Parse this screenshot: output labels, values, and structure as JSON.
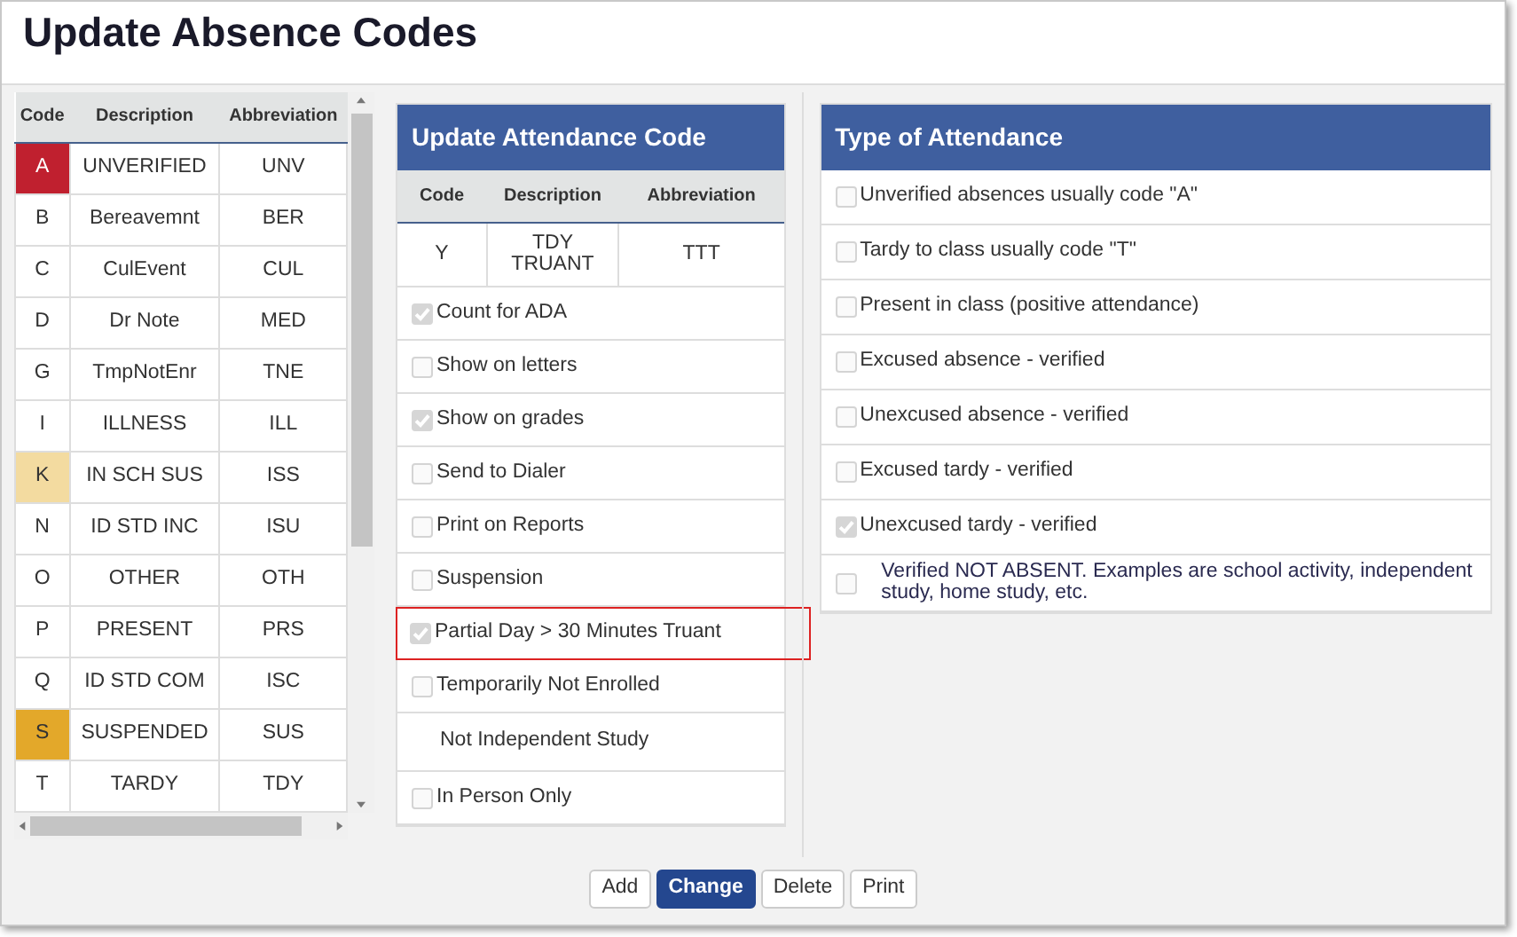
{
  "window": {
    "title": "Update Absence Codes"
  },
  "codes_table": {
    "columns": [
      "Code",
      "Description",
      "Abbreviation"
    ],
    "rows": [
      {
        "code": "A",
        "description": "UNVERIFIED",
        "abbreviation": "UNV",
        "color": "#c0202f"
      },
      {
        "code": "B",
        "description": "Bereavemnt",
        "abbreviation": "BER"
      },
      {
        "code": "C",
        "description": "CulEvent",
        "abbreviation": "CUL"
      },
      {
        "code": "D",
        "description": "Dr Note",
        "abbreviation": "MED"
      },
      {
        "code": "G",
        "description": "TmpNotEnr",
        "abbreviation": "TNE"
      },
      {
        "code": "I",
        "description": "ILLNESS",
        "abbreviation": "ILL"
      },
      {
        "code": "K",
        "description": "IN SCH SUS",
        "abbreviation": "ISS",
        "color": "#f3dba0"
      },
      {
        "code": "N",
        "description": "ID STD INC",
        "abbreviation": "ISU"
      },
      {
        "code": "O",
        "description": "OTHER",
        "abbreviation": "OTH"
      },
      {
        "code": "P",
        "description": "PRESENT",
        "abbreviation": "PRS"
      },
      {
        "code": "Q",
        "description": "ID STD COM",
        "abbreviation": "ISC"
      },
      {
        "code": "S",
        "description": "SUSPENDED",
        "abbreviation": "SUS",
        "color": "#e3a82a"
      },
      {
        "code": "T",
        "description": "TARDY",
        "abbreviation": "TDY"
      }
    ]
  },
  "update_panel": {
    "title": "Update Attendance Code",
    "columns": [
      "Code",
      "Description",
      "Abbreviation"
    ],
    "record": {
      "code": "Y",
      "description": "TDY TRUANT",
      "abbreviation": "TTT"
    },
    "options": [
      {
        "kind": "checkbox",
        "label": "Count for ADA",
        "checked": true,
        "highlighted": false
      },
      {
        "kind": "checkbox",
        "label": "Show on letters",
        "checked": false,
        "highlighted": false
      },
      {
        "kind": "checkbox",
        "label": "Show on grades",
        "checked": true,
        "highlighted": false
      },
      {
        "kind": "checkbox",
        "label": "Send to Dialer",
        "checked": false,
        "highlighted": false
      },
      {
        "kind": "checkbox",
        "label": "Print on Reports",
        "checked": false,
        "highlighted": false
      },
      {
        "kind": "checkbox",
        "label": "Suspension",
        "checked": false,
        "highlighted": false
      },
      {
        "kind": "checkbox",
        "label": "Partial Day > 30 Minutes Truant",
        "checked": true,
        "highlighted": true
      },
      {
        "kind": "checkbox",
        "label": "Temporarily Not Enrolled",
        "checked": false,
        "highlighted": false
      },
      {
        "kind": "label",
        "label": "Not Independent Study",
        "highlighted": false
      },
      {
        "kind": "checkbox",
        "label": "In Person Only",
        "checked": false,
        "highlighted": false
      }
    ]
  },
  "type_panel": {
    "title": "Type of Attendance",
    "options": [
      {
        "label": "Unverified absences usually code \"A\"",
        "checked": false
      },
      {
        "label": "Tardy to class usually code \"T\"",
        "checked": false
      },
      {
        "label": "Present in class (positive attendance)",
        "checked": false
      },
      {
        "label": "Excused absence - verified",
        "checked": false
      },
      {
        "label": "Unexcused absence - verified",
        "checked": false
      },
      {
        "label": "Excused tardy - verified",
        "checked": false
      },
      {
        "label": "Unexcused tardy - verified",
        "checked": true
      },
      {
        "label": "Verified NOT ABSENT. Examples are school activity, independent study, home study, etc.",
        "checked": false
      }
    ]
  },
  "buttons": [
    {
      "label": "Add",
      "primary": false
    },
    {
      "label": "Change",
      "primary": true
    },
    {
      "label": "Delete",
      "primary": false
    },
    {
      "label": "Print",
      "primary": false
    }
  ]
}
